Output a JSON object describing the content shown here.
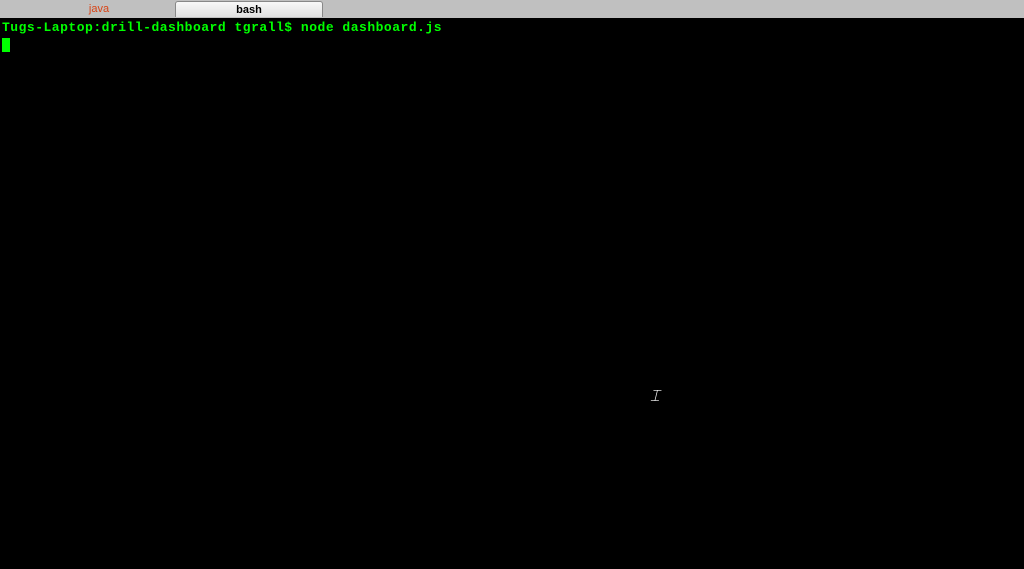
{
  "tabs": [
    {
      "label": "java",
      "active": false
    },
    {
      "label": "bash",
      "active": true
    }
  ],
  "terminal": {
    "prompt": {
      "host": "Tugs-Laptop",
      "path": "drill-dashboard",
      "user": "tgrall",
      "separator_host": ":",
      "separator_user": "$"
    },
    "command": "node dashboard.js"
  }
}
